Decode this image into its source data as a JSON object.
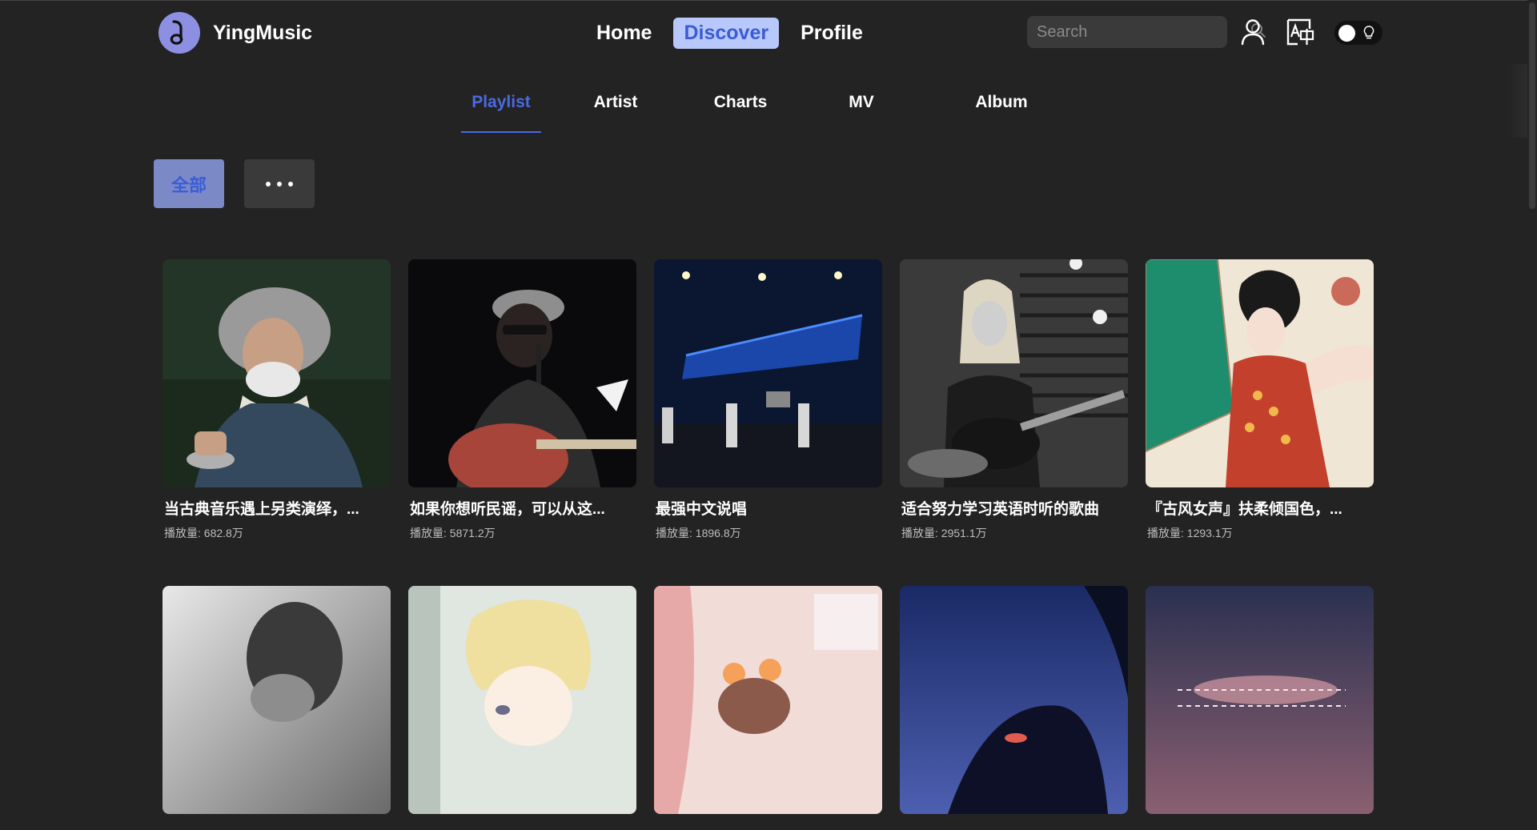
{
  "app": {
    "name": "YingMusic",
    "brand_color": "#8d8fe3",
    "accent_color": "#4b6ae3"
  },
  "nav": {
    "items": [
      {
        "label": "Home",
        "active": false
      },
      {
        "label": "Discover",
        "active": true
      },
      {
        "label": "Profile",
        "active": false
      }
    ]
  },
  "search": {
    "placeholder": "Search",
    "value": ""
  },
  "header_icons": [
    "user-icon",
    "translate-icon",
    "theme-toggle"
  ],
  "subtabs": [
    {
      "label": "Playlist",
      "active": true
    },
    {
      "label": "Artist",
      "active": false
    },
    {
      "label": "Charts",
      "active": false
    },
    {
      "label": "MV",
      "active": false
    },
    {
      "label": "Album",
      "active": false
    }
  ],
  "filters": {
    "all_label": "全部",
    "more_icon": "more-dots-icon"
  },
  "playlists": [
    {
      "title": "当古典音乐遇上另类演绎，...",
      "plays": "播放量: 682.8万"
    },
    {
      "title": "如果你想听民谣，可以从这...",
      "plays": "播放量: 5871.2万"
    },
    {
      "title": "最强中文说唱",
      "plays": "播放量: 1896.8万"
    },
    {
      "title": "适合努力学习英语时听的歌曲",
      "plays": "播放量: 2951.1万"
    },
    {
      "title": "『古风女声』扶柔倾国色，...",
      "plays": "播放量: 1293.1万"
    },
    {
      "title": "",
      "plays": ""
    },
    {
      "title": "",
      "plays": ""
    },
    {
      "title": "",
      "plays": ""
    },
    {
      "title": "",
      "plays": ""
    },
    {
      "title": "",
      "plays": ""
    }
  ]
}
